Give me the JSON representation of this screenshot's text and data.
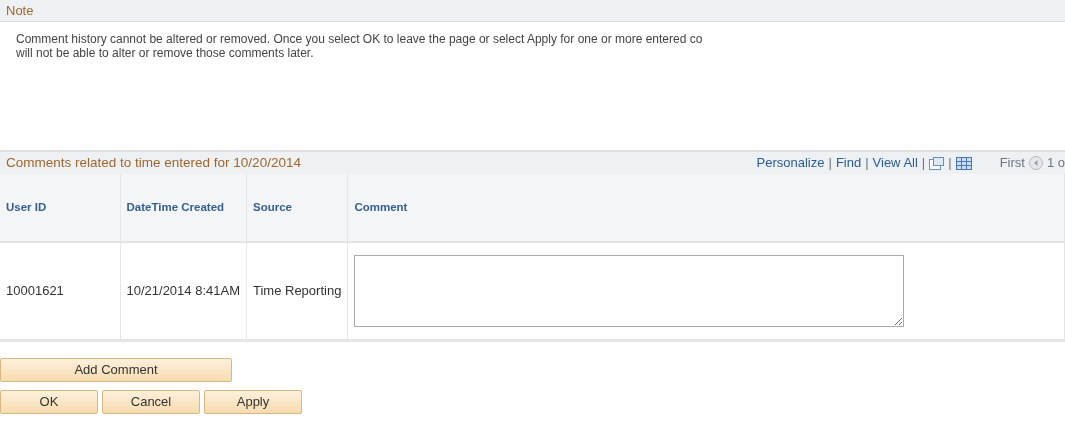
{
  "note": {
    "title": "Note",
    "text": "Comment history cannot be altered or removed. Once you select OK to leave the page or select Apply for one or more entered co",
    "text_line2": "will not be able to alter or remove those comments later."
  },
  "grid": {
    "title": "Comments related to time entered for 10/20/2014",
    "nav": [
      {
        "kind": "link",
        "label": "Personalize"
      },
      {
        "kind": "sep",
        "label": "|"
      },
      {
        "kind": "link",
        "label": "Find"
      },
      {
        "kind": "sep",
        "label": "|"
      },
      {
        "kind": "link",
        "label": "View All"
      },
      {
        "kind": "sep",
        "label": "|"
      },
      {
        "kind": "zoom-icon"
      },
      {
        "kind": "sep",
        "label": "|"
      },
      {
        "kind": "download-icon"
      }
    ],
    "pager": {
      "first": "First",
      "count": "1 o"
    },
    "columns": [
      "User ID",
      "DateTime Created",
      "Source",
      "Comment"
    ],
    "rows": [
      {
        "user_id": "10001621",
        "created": "10/21/2014  8:41AM",
        "source": "Time Reporting",
        "comment": ""
      }
    ]
  },
  "add_button": "Add Comment",
  "buttons": [
    "OK",
    "Cancel",
    "Apply"
  ]
}
